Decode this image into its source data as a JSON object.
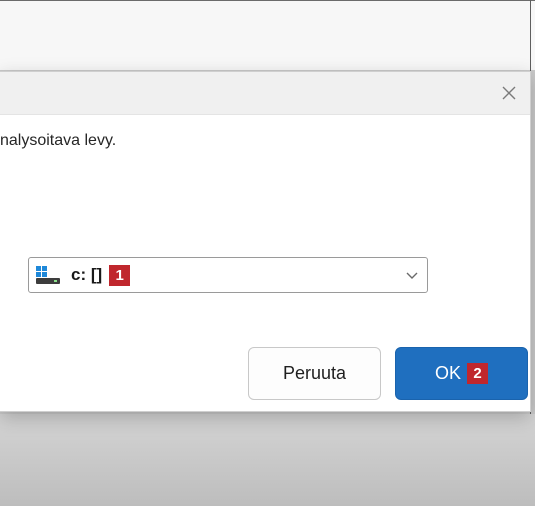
{
  "dialog": {
    "prompt": "nalysoitava levy.",
    "drive_select": {
      "selected_value": "c: []",
      "annotation": "1"
    },
    "buttons": {
      "cancel_label": "Peruuta",
      "ok_label": "OK",
      "ok_annotation": "2"
    }
  },
  "colors": {
    "primary": "#1f6fbf",
    "annotation_badge": "#c0272d"
  },
  "icons": {
    "close": "close-icon",
    "drive": "drive-icon",
    "dropdown": "chevron-down-icon"
  }
}
